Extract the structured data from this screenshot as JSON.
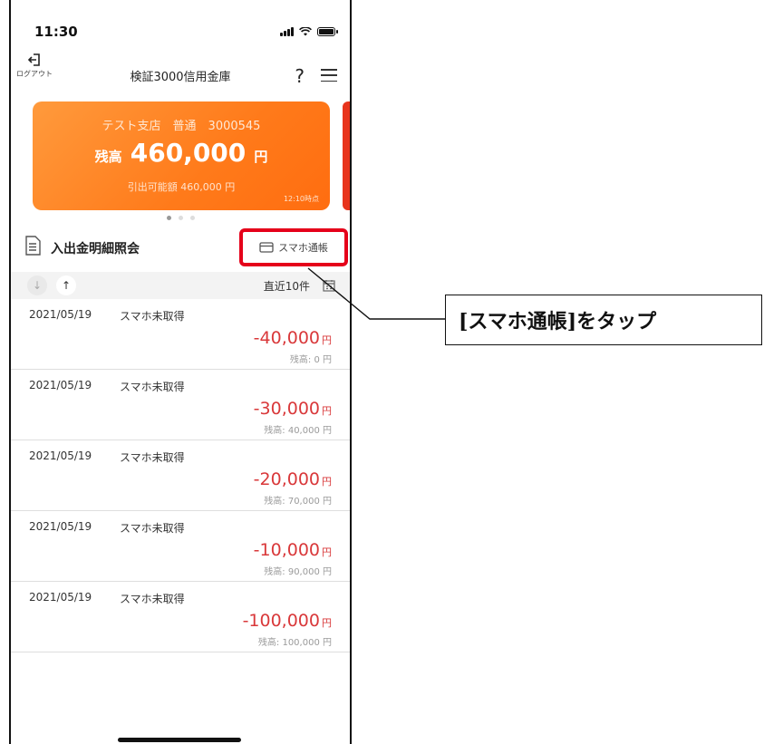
{
  "status_bar": {
    "time": "11:30"
  },
  "header": {
    "logout_label": "ログアウト",
    "bank_name": "検証3000信用金庫",
    "help_label": "?"
  },
  "account_card": {
    "branch_info": "テスト支店　普通　3000545",
    "balance_label": "残高",
    "balance_amount": "460,000",
    "currency": "円",
    "available_text": "引出可能額 460,000 円",
    "updated_time": "12:10時点",
    "colors": {
      "card": "#ff7a1a",
      "next_card": "#e8341c"
    }
  },
  "pager": {
    "count": 3,
    "active": 0
  },
  "transactions_section": {
    "title": "入出金明細照会",
    "passbook_button": "スマホ通帳",
    "sort_desc_symbol": "↓",
    "sort_asc_symbol": "↑",
    "period_label": "直近10件"
  },
  "transactions": [
    {
      "date": "2021/05/19",
      "description": "スマホ未取得",
      "amount": "-40,000",
      "currency": "円",
      "balance": "残高: 0 円"
    },
    {
      "date": "2021/05/19",
      "description": "スマホ未取得",
      "amount": "-30,000",
      "currency": "円",
      "balance": "残高: 40,000 円"
    },
    {
      "date": "2021/05/19",
      "description": "スマホ未取得",
      "amount": "-20,000",
      "currency": "円",
      "balance": "残高: 70,000 円"
    },
    {
      "date": "2021/05/19",
      "description": "スマホ未取得",
      "amount": "-10,000",
      "currency": "円",
      "balance": "残高: 90,000 円"
    },
    {
      "date": "2021/05/19",
      "description": "スマホ未取得",
      "amount": "-100,000",
      "currency": "円",
      "balance": "残高: 100,000 円"
    }
  ],
  "callout": {
    "text": "[スマホ通帳]をタップ",
    "highlight_color": "#e5001a"
  },
  "colors": {
    "negative_amount": "#d9383a"
  }
}
